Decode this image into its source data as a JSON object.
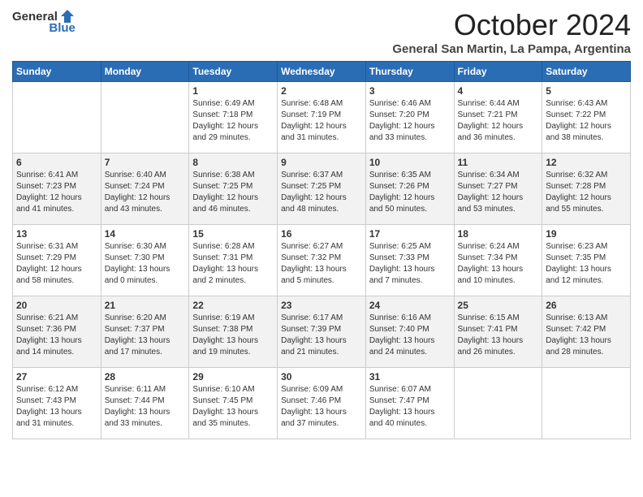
{
  "logo": {
    "general": "General",
    "blue": "Blue"
  },
  "title": "October 2024",
  "location": "General San Martin, La Pampa, Argentina",
  "days_of_week": [
    "Sunday",
    "Monday",
    "Tuesday",
    "Wednesday",
    "Thursday",
    "Friday",
    "Saturday"
  ],
  "weeks": [
    [
      {
        "day": "",
        "sunrise": "",
        "sunset": "",
        "daylight": ""
      },
      {
        "day": "",
        "sunrise": "",
        "sunset": "",
        "daylight": ""
      },
      {
        "day": "1",
        "sunrise": "Sunrise: 6:49 AM",
        "sunset": "Sunset: 7:18 PM",
        "daylight": "Daylight: 12 hours and 29 minutes."
      },
      {
        "day": "2",
        "sunrise": "Sunrise: 6:48 AM",
        "sunset": "Sunset: 7:19 PM",
        "daylight": "Daylight: 12 hours and 31 minutes."
      },
      {
        "day": "3",
        "sunrise": "Sunrise: 6:46 AM",
        "sunset": "Sunset: 7:20 PM",
        "daylight": "Daylight: 12 hours and 33 minutes."
      },
      {
        "day": "4",
        "sunrise": "Sunrise: 6:44 AM",
        "sunset": "Sunset: 7:21 PM",
        "daylight": "Daylight: 12 hours and 36 minutes."
      },
      {
        "day": "5",
        "sunrise": "Sunrise: 6:43 AM",
        "sunset": "Sunset: 7:22 PM",
        "daylight": "Daylight: 12 hours and 38 minutes."
      }
    ],
    [
      {
        "day": "6",
        "sunrise": "Sunrise: 6:41 AM",
        "sunset": "Sunset: 7:23 PM",
        "daylight": "Daylight: 12 hours and 41 minutes."
      },
      {
        "day": "7",
        "sunrise": "Sunrise: 6:40 AM",
        "sunset": "Sunset: 7:24 PM",
        "daylight": "Daylight: 12 hours and 43 minutes."
      },
      {
        "day": "8",
        "sunrise": "Sunrise: 6:38 AM",
        "sunset": "Sunset: 7:25 PM",
        "daylight": "Daylight: 12 hours and 46 minutes."
      },
      {
        "day": "9",
        "sunrise": "Sunrise: 6:37 AM",
        "sunset": "Sunset: 7:25 PM",
        "daylight": "Daylight: 12 hours and 48 minutes."
      },
      {
        "day": "10",
        "sunrise": "Sunrise: 6:35 AM",
        "sunset": "Sunset: 7:26 PM",
        "daylight": "Daylight: 12 hours and 50 minutes."
      },
      {
        "day": "11",
        "sunrise": "Sunrise: 6:34 AM",
        "sunset": "Sunset: 7:27 PM",
        "daylight": "Daylight: 12 hours and 53 minutes."
      },
      {
        "day": "12",
        "sunrise": "Sunrise: 6:32 AM",
        "sunset": "Sunset: 7:28 PM",
        "daylight": "Daylight: 12 hours and 55 minutes."
      }
    ],
    [
      {
        "day": "13",
        "sunrise": "Sunrise: 6:31 AM",
        "sunset": "Sunset: 7:29 PM",
        "daylight": "Daylight: 12 hours and 58 minutes."
      },
      {
        "day": "14",
        "sunrise": "Sunrise: 6:30 AM",
        "sunset": "Sunset: 7:30 PM",
        "daylight": "Daylight: 13 hours and 0 minutes."
      },
      {
        "day": "15",
        "sunrise": "Sunrise: 6:28 AM",
        "sunset": "Sunset: 7:31 PM",
        "daylight": "Daylight: 13 hours and 2 minutes."
      },
      {
        "day": "16",
        "sunrise": "Sunrise: 6:27 AM",
        "sunset": "Sunset: 7:32 PM",
        "daylight": "Daylight: 13 hours and 5 minutes."
      },
      {
        "day": "17",
        "sunrise": "Sunrise: 6:25 AM",
        "sunset": "Sunset: 7:33 PM",
        "daylight": "Daylight: 13 hours and 7 minutes."
      },
      {
        "day": "18",
        "sunrise": "Sunrise: 6:24 AM",
        "sunset": "Sunset: 7:34 PM",
        "daylight": "Daylight: 13 hours and 10 minutes."
      },
      {
        "day": "19",
        "sunrise": "Sunrise: 6:23 AM",
        "sunset": "Sunset: 7:35 PM",
        "daylight": "Daylight: 13 hours and 12 minutes."
      }
    ],
    [
      {
        "day": "20",
        "sunrise": "Sunrise: 6:21 AM",
        "sunset": "Sunset: 7:36 PM",
        "daylight": "Daylight: 13 hours and 14 minutes."
      },
      {
        "day": "21",
        "sunrise": "Sunrise: 6:20 AM",
        "sunset": "Sunset: 7:37 PM",
        "daylight": "Daylight: 13 hours and 17 minutes."
      },
      {
        "day": "22",
        "sunrise": "Sunrise: 6:19 AM",
        "sunset": "Sunset: 7:38 PM",
        "daylight": "Daylight: 13 hours and 19 minutes."
      },
      {
        "day": "23",
        "sunrise": "Sunrise: 6:17 AM",
        "sunset": "Sunset: 7:39 PM",
        "daylight": "Daylight: 13 hours and 21 minutes."
      },
      {
        "day": "24",
        "sunrise": "Sunrise: 6:16 AM",
        "sunset": "Sunset: 7:40 PM",
        "daylight": "Daylight: 13 hours and 24 minutes."
      },
      {
        "day": "25",
        "sunrise": "Sunrise: 6:15 AM",
        "sunset": "Sunset: 7:41 PM",
        "daylight": "Daylight: 13 hours and 26 minutes."
      },
      {
        "day": "26",
        "sunrise": "Sunrise: 6:13 AM",
        "sunset": "Sunset: 7:42 PM",
        "daylight": "Daylight: 13 hours and 28 minutes."
      }
    ],
    [
      {
        "day": "27",
        "sunrise": "Sunrise: 6:12 AM",
        "sunset": "Sunset: 7:43 PM",
        "daylight": "Daylight: 13 hours and 31 minutes."
      },
      {
        "day": "28",
        "sunrise": "Sunrise: 6:11 AM",
        "sunset": "Sunset: 7:44 PM",
        "daylight": "Daylight: 13 hours and 33 minutes."
      },
      {
        "day": "29",
        "sunrise": "Sunrise: 6:10 AM",
        "sunset": "Sunset: 7:45 PM",
        "daylight": "Daylight: 13 hours and 35 minutes."
      },
      {
        "day": "30",
        "sunrise": "Sunrise: 6:09 AM",
        "sunset": "Sunset: 7:46 PM",
        "daylight": "Daylight: 13 hours and 37 minutes."
      },
      {
        "day": "31",
        "sunrise": "Sunrise: 6:07 AM",
        "sunset": "Sunset: 7:47 PM",
        "daylight": "Daylight: 13 hours and 40 minutes."
      },
      {
        "day": "",
        "sunrise": "",
        "sunset": "",
        "daylight": ""
      },
      {
        "day": "",
        "sunrise": "",
        "sunset": "",
        "daylight": ""
      }
    ]
  ]
}
